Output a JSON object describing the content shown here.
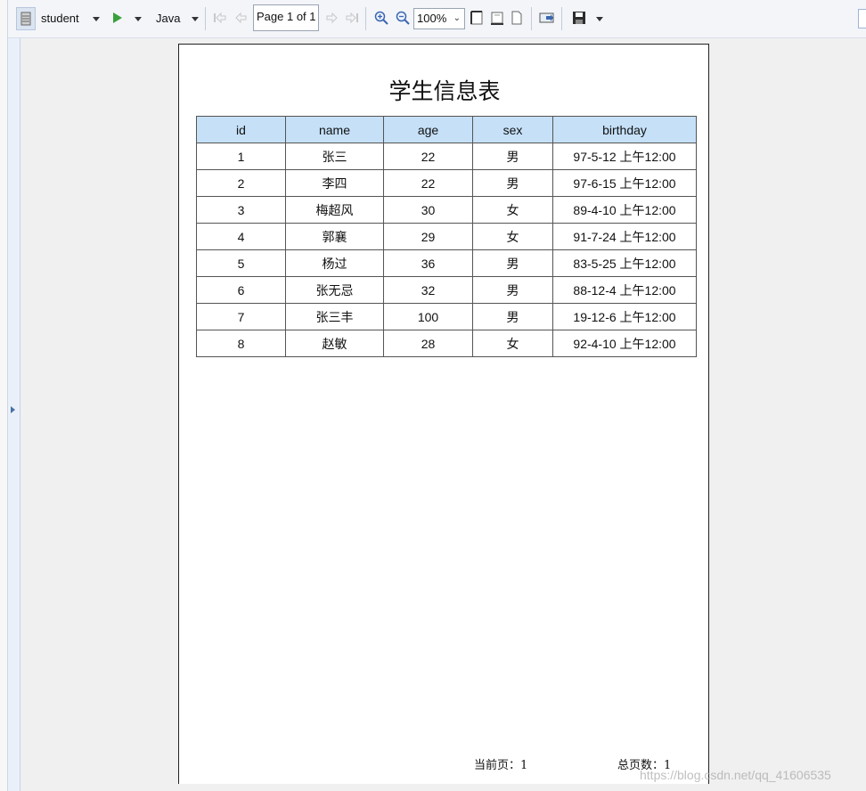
{
  "toolbar": {
    "dataset": "student",
    "language": "Java",
    "page_indicator": "Page 1 of 1",
    "zoom": "100%"
  },
  "report": {
    "title": "学生信息表",
    "columns": [
      "id",
      "name",
      "age",
      "sex",
      "birthday"
    ],
    "rows": [
      [
        "1",
        "张三",
        "22",
        "男",
        "97-5-12 上午12:00"
      ],
      [
        "2",
        "李四",
        "22",
        "男",
        "97-6-15 上午12:00"
      ],
      [
        "3",
        "梅超风",
        "30",
        "女",
        "89-4-10 上午12:00"
      ],
      [
        "4",
        "郭襄",
        "29",
        "女",
        "91-7-24 上午12:00"
      ],
      [
        "5",
        "杨过",
        "36",
        "男",
        "83-5-25 上午12:00"
      ],
      [
        "6",
        "张无忌",
        "32",
        "男",
        "88-12-4 上午12:00"
      ],
      [
        "7",
        "张三丰",
        "100",
        "男",
        "19-12-6 上午12:00"
      ],
      [
        "8",
        "赵敏",
        "28",
        "女",
        "92-4-10 上午12:00"
      ]
    ],
    "footer": {
      "current_page_label": "当前页：1",
      "total_pages_label": "总页数：1"
    }
  },
  "watermark": "https://blog.csdn.net/qq_41606535",
  "colors": {
    "header_fill": "#c5e0f7",
    "run_icon": "#3aa03a",
    "toolbar_bg": "#f3f5f9"
  }
}
